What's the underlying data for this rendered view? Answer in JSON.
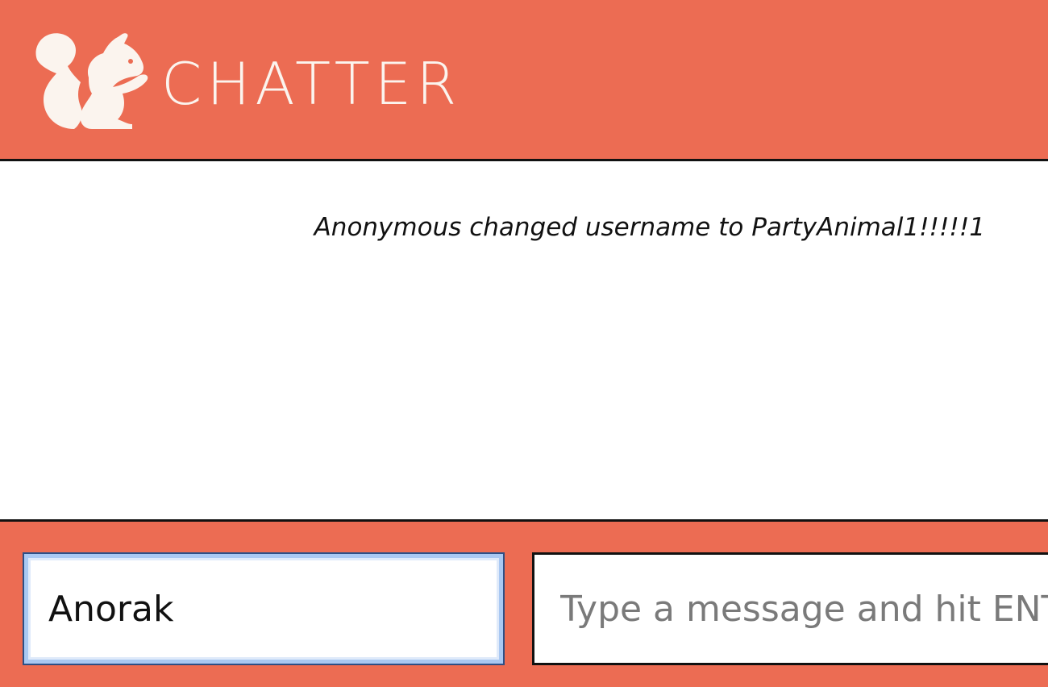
{
  "app": {
    "brand": "CHATTER",
    "logo_icon": "squirrel-icon",
    "colors": {
      "accent": "#ec6c53",
      "logo": "#fbf4ee",
      "border": "#111111",
      "focus": "#a9c8f2"
    }
  },
  "messages": [
    {
      "type": "system",
      "text": "Anonymous changed username to PartyAnimal1!!!!!1"
    }
  ],
  "footer": {
    "username": {
      "value": "Anorak"
    },
    "message": {
      "value": "",
      "placeholder": "Type a message and hit ENTER"
    }
  }
}
